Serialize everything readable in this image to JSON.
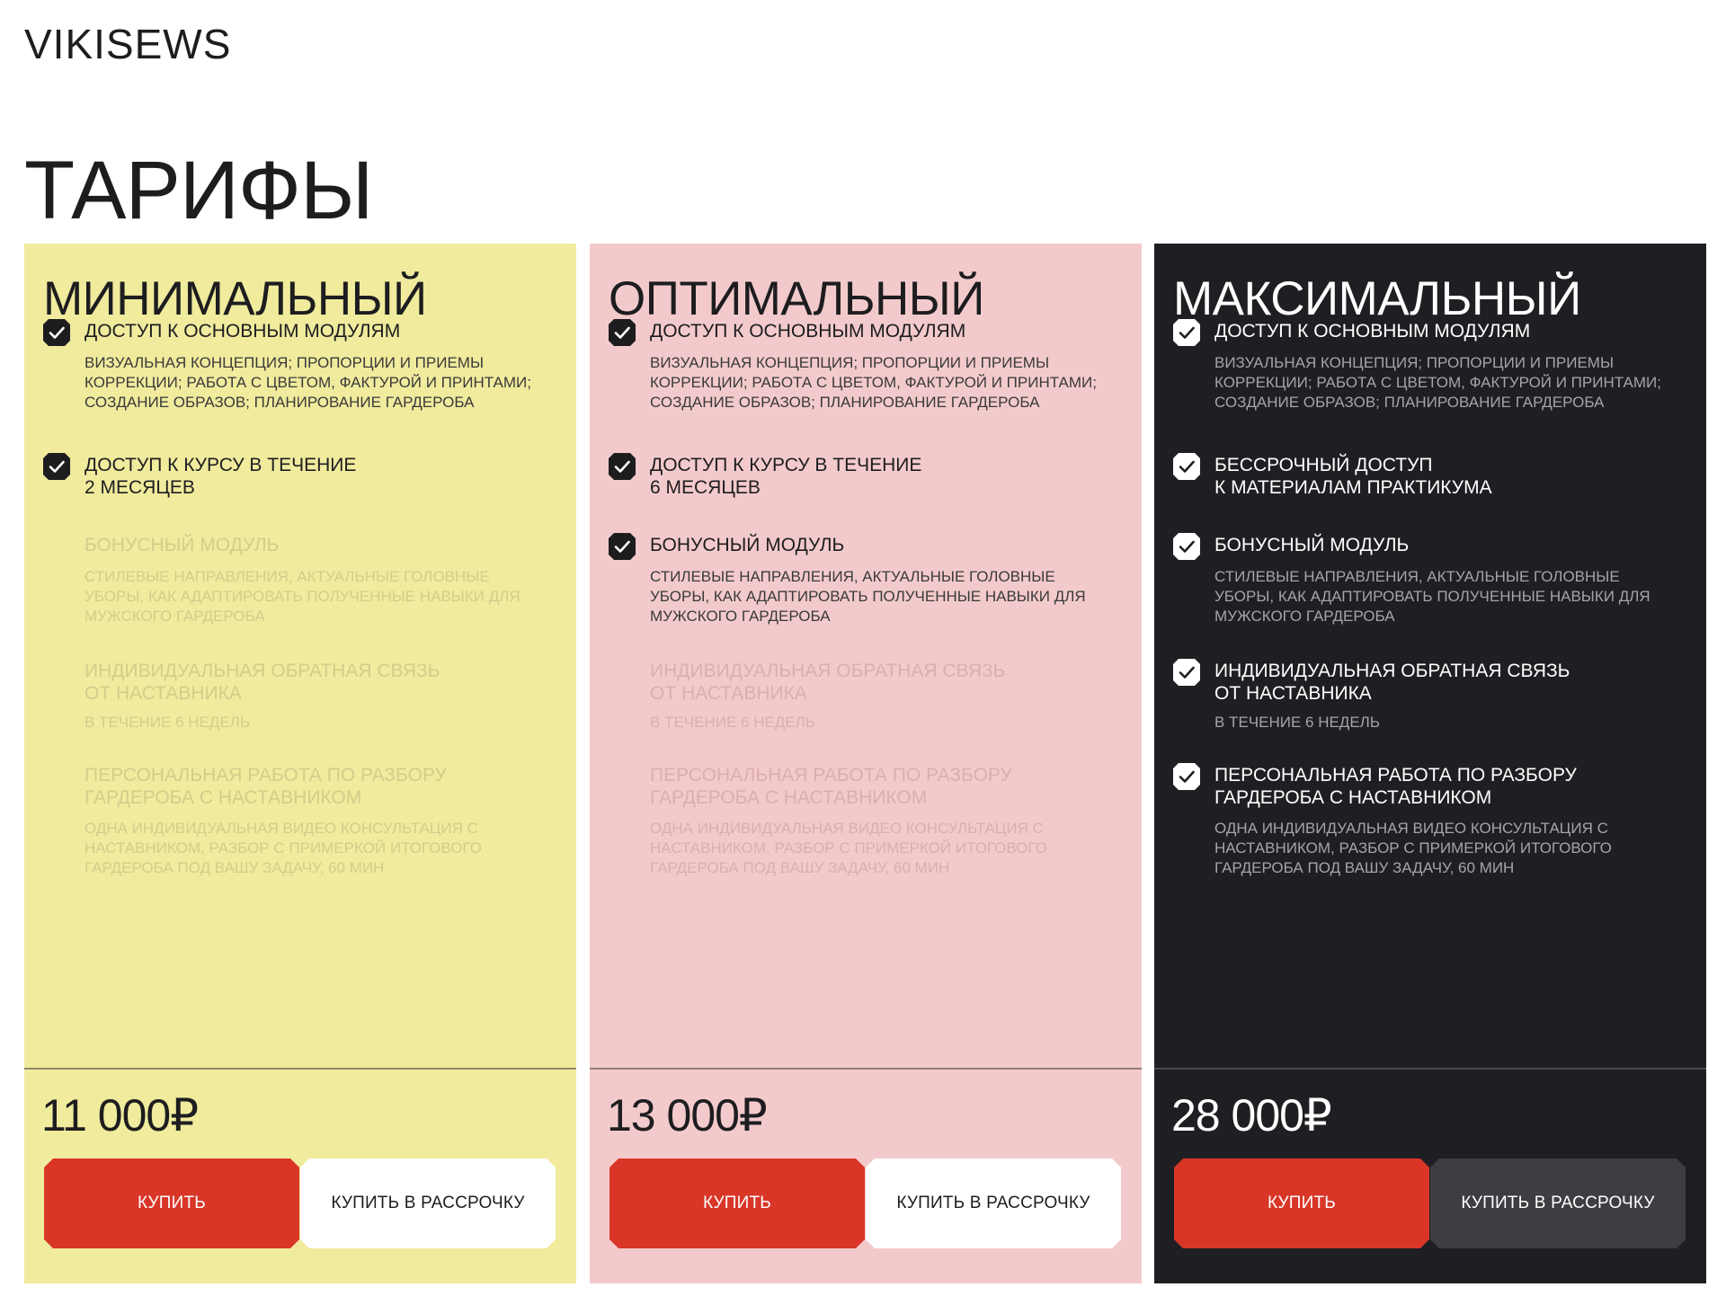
{
  "header": {
    "logo": "VIKISEWS"
  },
  "page": {
    "title": "ТАРИФЫ"
  },
  "colors": {
    "card_min_bg": "#f0eb9d",
    "card_opt_bg": "#f3cacb",
    "card_max_bg": "#1f1f23",
    "buy_button": "#d93628",
    "dark_text": "#1d1d20",
    "muted_text_light": "#3a3a3a",
    "disabled_text_light": "#d2cd8a",
    "disabled_text_pink": "#dbaeaf",
    "max_desc_text": "#a5a5a8",
    "installment_dark_bg": "#3e3e42"
  },
  "plans": [
    {
      "name": "МИНИМАЛЬНЫЙ",
      "price": "11 000₽",
      "buy_label": "КУПИТЬ",
      "installment_label": "КУПИТЬ В РАССРОЧКУ",
      "features": [
        {
          "title": "ДОСТУП К ОСНОВНЫМ МОДУЛЯМ",
          "desc": "ВИЗУАЛЬНАЯ КОНЦЕПЦИЯ; ПРОПОРЦИИ И ПРИЕМЫ\nКОРРЕКЦИИ; РАБОТА С ЦВЕТОМ, ФАКТУРОЙ И ПРИНТАМИ;\nСОЗДАНИЕ ОБРАЗОВ; ПЛАНИРОВАНИЕ ГАРДЕРОБА",
          "included": true,
          "icon": "check-icon"
        },
        {
          "title": "ДОСТУП К КУРСУ В ТЕЧЕНИЕ\n2 МЕСЯЦЕВ",
          "desc": "",
          "included": true,
          "icon": "check-icon"
        },
        {
          "title": "БОНУСНЫЙ МОДУЛЬ",
          "desc": "СТИЛЕВЫЕ НАПРАВЛЕНИЯ, АКТУАЛЬНЫЕ ГОЛОВНЫЕ\nУБОРЫ, КАК АДАПТИРОВАТЬ ПОЛУЧЕННЫЕ НАВЫКИ ДЛЯ\nМУЖСКОГО ГАРДЕРОБА",
          "included": false
        },
        {
          "title": "ИНДИВИДУАЛЬНАЯ ОБРАТНАЯ СВЯЗЬ\nОТ НАСТАВНИКА",
          "desc": "В ТЕЧЕНИЕ 6 НЕДЕЛЬ",
          "included": false
        },
        {
          "title": "ПЕРСОНАЛЬНАЯ РАБОТА ПО РАЗБОРУ\nГАРДЕРОБА С НАСТАВНИКОМ",
          "desc": "ОДНА ИНДИВИДУАЛЬНАЯ ВИДЕО КОНСУЛЬТАЦИЯ С\nНАСТАВНИКОМ, РАЗБОР С ПРИМЕРКОЙ ИТОГОВОГО\nГАРДЕРОБА ПОД ВАШУ ЗАДАЧУ, 60 МИН",
          "included": false
        }
      ]
    },
    {
      "name": "ОПТИМАЛЬНЫЙ",
      "price": "13 000₽",
      "buy_label": "КУПИТЬ",
      "installment_label": "КУПИТЬ В РАССРОЧКУ",
      "features": [
        {
          "title": "ДОСТУП К ОСНОВНЫМ МОДУЛЯМ",
          "desc": "ВИЗУАЛЬНАЯ КОНЦЕПЦИЯ; ПРОПОРЦИИ И ПРИЕМЫ\nКОРРЕКЦИИ; РАБОТА С ЦВЕТОМ, ФАКТУРОЙ И ПРИНТАМИ;\nСОЗДАНИЕ ОБРАЗОВ; ПЛАНИРОВАНИЕ ГАРДЕРОБА",
          "included": true,
          "icon": "check-icon"
        },
        {
          "title": "ДОСТУП К КУРСУ В ТЕЧЕНИЕ\n6 МЕСЯЦЕВ",
          "desc": "",
          "included": true,
          "icon": "check-icon"
        },
        {
          "title": "БОНУСНЫЙ МОДУЛЬ",
          "desc": "СТИЛЕВЫЕ НАПРАВЛЕНИЯ, АКТУАЛЬНЫЕ ГОЛОВНЫЕ\nУБОРЫ, КАК АДАПТИРОВАТЬ ПОЛУЧЕННЫЕ НАВЫКИ ДЛЯ\nМУЖСКОГО ГАРДЕРОБА",
          "included": true,
          "icon": "check-icon"
        },
        {
          "title": "ИНДИВИДУАЛЬНАЯ ОБРАТНАЯ СВЯЗЬ\nОТ НАСТАВНИКА",
          "desc": "В ТЕЧЕНИЕ 6 НЕДЕЛЬ",
          "included": false
        },
        {
          "title": "ПЕРСОНАЛЬНАЯ РАБОТА ПО РАЗБОРУ\nГАРДЕРОБА С НАСТАВНИКОМ",
          "desc": "ОДНА ИНДИВИДУАЛЬНАЯ ВИДЕО КОНСУЛЬТАЦИЯ С\nНАСТАВНИКОМ, РАЗБОР С ПРИМЕРКОЙ ИТОГОВОГО\nГАРДЕРОБА ПОД ВАШУ ЗАДАЧУ, 60 МИН",
          "included": false
        }
      ]
    },
    {
      "name": "МАКСИМАЛЬНЫЙ",
      "price": "28 000₽",
      "buy_label": "КУПИТЬ",
      "installment_label": "КУПИТЬ В РАССРОЧКУ",
      "features": [
        {
          "title": "ДОСТУП К ОСНОВНЫМ МОДУЛЯМ",
          "desc": "ВИЗУАЛЬНАЯ КОНЦЕПЦИЯ; ПРОПОРЦИИ И ПРИЕМЫ\nКОРРЕКЦИИ; РАБОТА С ЦВЕТОМ, ФАКТУРОЙ И ПРИНТАМИ;\nСОЗДАНИЕ ОБРАЗОВ; ПЛАНИРОВАНИЕ ГАРДЕРОБА",
          "included": true,
          "icon": "check-icon"
        },
        {
          "title": "БЕССРОЧНЫЙ ДОСТУП\nК МАТЕРИАЛАМ ПРАКТИКУМА",
          "desc": "",
          "included": true,
          "icon": "check-icon"
        },
        {
          "title": "БОНУСНЫЙ МОДУЛЬ",
          "desc": "СТИЛЕВЫЕ НАПРАВЛЕНИЯ, АКТУАЛЬНЫЕ ГОЛОВНЫЕ\nУБОРЫ, КАК АДАПТИРОВАТЬ ПОЛУЧЕННЫЕ НАВЫКИ ДЛЯ\nМУЖСКОГО ГАРДЕРОБА",
          "included": true,
          "icon": "check-icon"
        },
        {
          "title": "ИНДИВИДУАЛЬНАЯ ОБРАТНАЯ СВЯЗЬ\nОТ НАСТАВНИКА",
          "desc": "В ТЕЧЕНИЕ 6 НЕДЕЛЬ",
          "included": true,
          "icon": "check-icon"
        },
        {
          "title": "ПЕРСОНАЛЬНАЯ РАБОТА ПО РАЗБОРУ\nГАРДЕРОБА С НАСТАВНИКОМ",
          "desc": "ОДНА ИНДИВИДУАЛЬНАЯ ВИДЕО КОНСУЛЬТАЦИЯ С\nНАСТАВНИКОМ, РАЗБОР С ПРИМЕРКОЙ ИТОГОВОГО\nГАРДЕРОБА ПОД ВАШУ ЗАДАЧУ, 60 МИН",
          "included": true,
          "icon": "check-icon"
        }
      ]
    }
  ]
}
